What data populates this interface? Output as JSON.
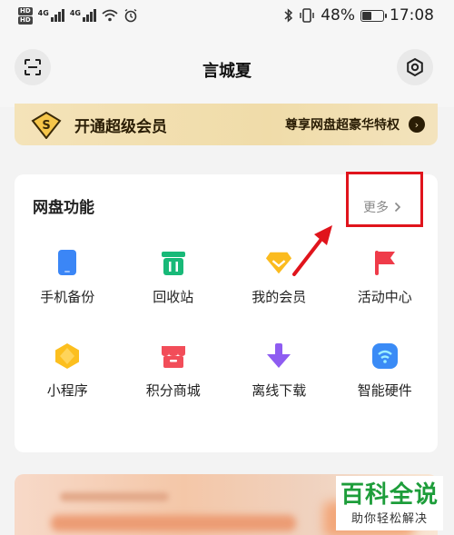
{
  "status_bar": {
    "hd1": "HD",
    "hd2": "HD",
    "sig1": "4G",
    "sig2": "4G",
    "battery_pct": "48%",
    "time": "17:08"
  },
  "header": {
    "title": "言城夏",
    "left_icon": "scan-icon",
    "right_icon": "settings-icon"
  },
  "vip_banner": {
    "badge": "S",
    "title": "开通超级会员",
    "subtitle": "尊享网盘超豪华特权",
    "arrow": "›"
  },
  "features": {
    "title": "网盘功能",
    "more_label": "更多",
    "items": [
      {
        "label": "手机备份",
        "icon": "phone-icon",
        "color": "#3b86f6"
      },
      {
        "label": "回收站",
        "icon": "trash-icon",
        "color": "#18b978"
      },
      {
        "label": "我的会员",
        "icon": "diamond-icon",
        "color": "#fbbb1e"
      },
      {
        "label": "活动中心",
        "icon": "flag-icon",
        "color": "#ef3b49"
      },
      {
        "label": "小程序",
        "icon": "hexagon-icon",
        "color": "#fcbf1f"
      },
      {
        "label": "积分商城",
        "icon": "shop-icon",
        "color": "#f24d59"
      },
      {
        "label": "离线下载",
        "icon": "download-arrow-icon",
        "color": "#8e5cf1"
      },
      {
        "label": "智能硬件",
        "icon": "smart-device-icon",
        "color": "#3a8bf6"
      }
    ]
  },
  "watermark": {
    "title": "百科全说",
    "subtitle": "助你轻松解决"
  },
  "colors": {
    "highlight": "#e0141c",
    "vip_bg": "#f1dfb0",
    "watermark_green": "#1d9d3a"
  }
}
